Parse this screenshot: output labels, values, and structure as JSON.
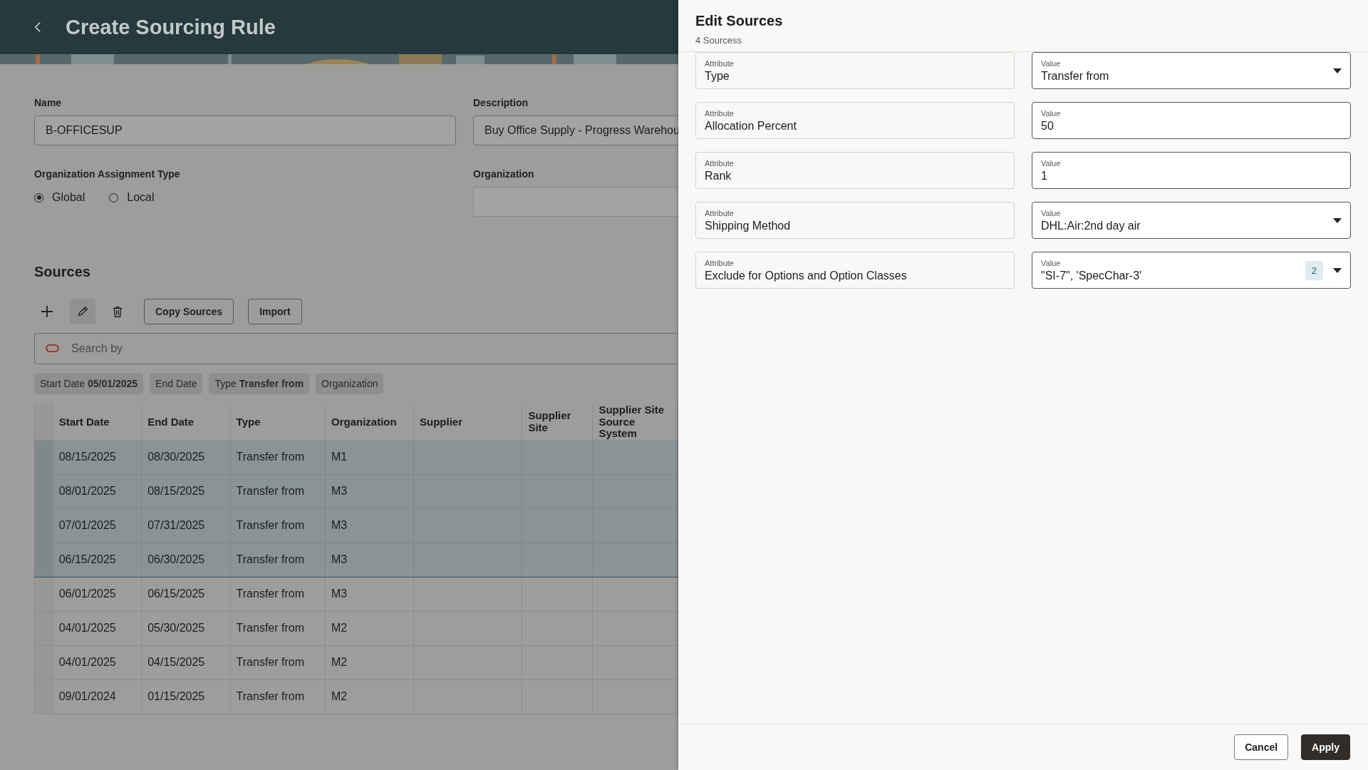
{
  "header": {
    "title": "Create Sourcing Rule"
  },
  "form": {
    "name": {
      "label": "Name",
      "value": "B-OFFICESUP"
    },
    "description": {
      "label": "Description",
      "value": "Buy Office Supply - Progress Warehou"
    },
    "assignment": {
      "label": "Organization Assignment Type",
      "options": [
        {
          "label": "Global",
          "selected": true
        },
        {
          "label": "Local",
          "selected": false
        }
      ]
    },
    "organization": {
      "label": "Organization"
    }
  },
  "sources": {
    "title": "Sources",
    "buttons": [
      "Copy Sources",
      "Import"
    ],
    "search": {
      "placeholder": "Search by"
    },
    "filters": [
      {
        "label": "Start Date",
        "value": "05/01/2025"
      },
      {
        "label": "End Date"
      },
      {
        "label": "Type",
        "value": "Transfer from"
      },
      {
        "label": "Organization"
      }
    ],
    "table": {
      "columns": [
        "Start Date",
        "End Date",
        "Type",
        "Organization",
        "Supplier",
        "Supplier Site",
        "Supplier Site Source System"
      ],
      "rows": [
        {
          "cells": [
            "08/15/2025",
            "08/30/2025",
            "Transfer from",
            "M1"
          ],
          "selected": true
        },
        {
          "cells": [
            "08/01/2025",
            "08/15/2025",
            "Transfer from",
            "M3"
          ],
          "selected": true
        },
        {
          "cells": [
            "07/01/2025",
            "07/31/2025",
            "Transfer from",
            "M3"
          ],
          "selected": true
        },
        {
          "cells": [
            "06/15/2025",
            "06/30/2025",
            "Transfer from",
            "M3"
          ],
          "selected": true
        },
        {
          "cells": [
            "06/01/2025",
            "06/15/2025",
            "Transfer from",
            "M3"
          ],
          "selected": false
        },
        {
          "cells": [
            "04/01/2025",
            "05/30/2025",
            "Transfer from",
            "M2"
          ],
          "selected": false
        },
        {
          "cells": [
            "04/01/2025",
            "04/15/2025",
            "Transfer from",
            "M2"
          ],
          "selected": false
        },
        {
          "cells": [
            "09/01/2024",
            "01/15/2025",
            "Transfer from",
            "M2"
          ],
          "selected": false
        }
      ]
    }
  },
  "panel": {
    "title": "Edit Sources",
    "subtitle": "4 Sourcess",
    "rows": [
      {
        "attribute_label": "Attribute",
        "attribute": "Type",
        "value_label": "Value",
        "value": "Transfer from",
        "kind": "select"
      },
      {
        "attribute_label": "Attribute",
        "attribute": "Allocation Percent",
        "value_label": "Value",
        "value": "50",
        "kind": "text"
      },
      {
        "attribute_label": "Attribute",
        "attribute": "Rank",
        "value_label": "Value",
        "value": "1",
        "kind": "text"
      },
      {
        "attribute_label": "Attribute",
        "attribute": "Shipping Method",
        "value_label": "Value",
        "value": "DHL:Air:2nd day air",
        "kind": "select"
      },
      {
        "attribute_label": "Attribute",
        "attribute": "Exclude for Options and Option Classes",
        "value_label": "Value",
        "value": "\"SI-7\", 'SpecChar-3'",
        "kind": "multiselect",
        "count": "2"
      }
    ],
    "buttons": [
      "Cancel",
      "Apply"
    ]
  }
}
